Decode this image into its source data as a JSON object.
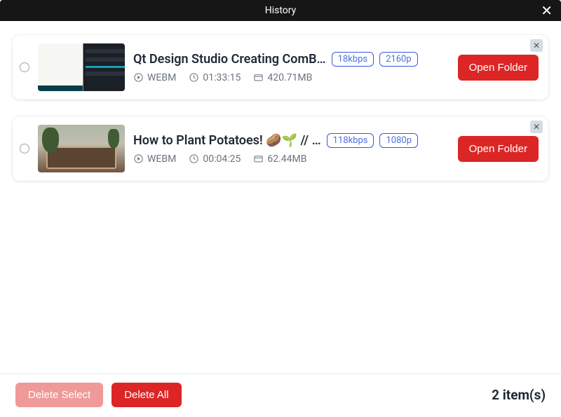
{
  "window": {
    "title": "History"
  },
  "items": [
    {
      "title": "Qt Design Studio Creating ComB…",
      "bitrate": "18kbps",
      "resolution": "2160p",
      "format": "WEBM",
      "duration": "01:33:15",
      "size": "420.71MB",
      "action": "Open Folder"
    },
    {
      "title": "How to Plant Potatoes! 🥔🌱 // …",
      "bitrate": "118kbps",
      "resolution": "1080p",
      "format": "WEBM",
      "duration": "00:04:25",
      "size": "62.44MB",
      "action": "Open Folder"
    }
  ],
  "footer": {
    "delete_select": "Delete Select",
    "delete_all": "Delete All",
    "count": "2 item(s)"
  }
}
